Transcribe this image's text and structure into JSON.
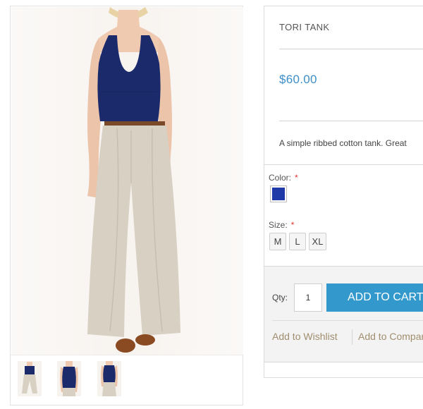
{
  "product": {
    "name": "TORI TANK",
    "price": "$60.00",
    "description": "A simple ribbed cotton tank. Great"
  },
  "options": {
    "color": {
      "label": "Color:",
      "required_mark": "*",
      "swatch_color": "#1f3aa8"
    },
    "size": {
      "label": "Size:",
      "required_mark": "*",
      "values": [
        "M",
        "L",
        "XL"
      ]
    }
  },
  "cart": {
    "qty_label": "Qty:",
    "qty_value": "1",
    "add_to_cart_label": "ADD TO CART"
  },
  "links": {
    "wishlist": "Add to Wishlist",
    "compare": "Add to Compare"
  },
  "colors": {
    "accent": "#3399cc",
    "price": "#3d8ec7",
    "tank": "#1b2a6b",
    "pants": "#d8d0c3"
  }
}
